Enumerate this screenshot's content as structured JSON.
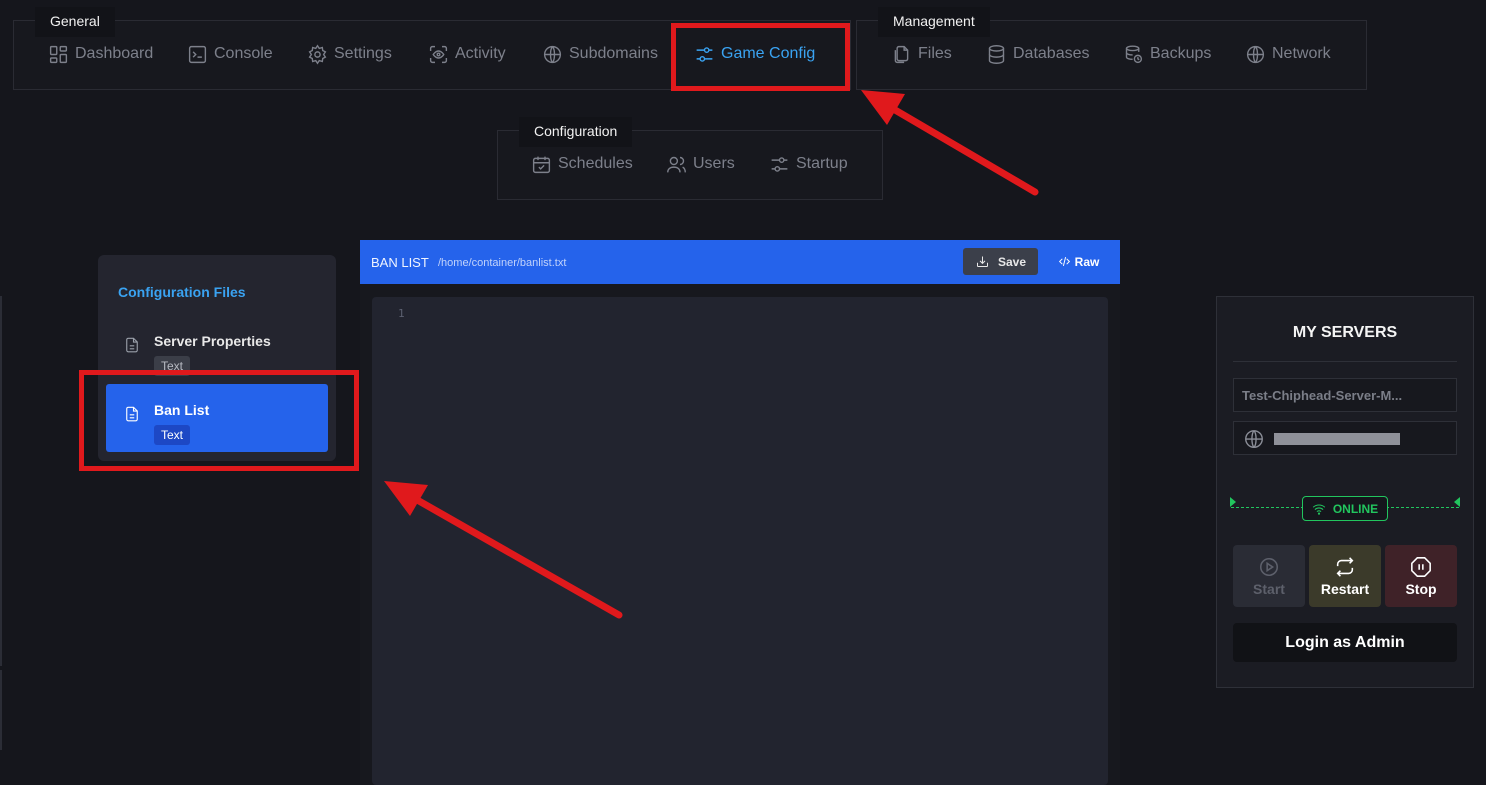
{
  "nav": {
    "general": {
      "label": "General",
      "items": [
        {
          "label": "Dashboard",
          "icon": "dashboard-icon"
        },
        {
          "label": "Console",
          "icon": "console-icon"
        },
        {
          "label": "Settings",
          "icon": "gear-icon"
        },
        {
          "label": "Activity",
          "icon": "activity-icon"
        },
        {
          "label": "Subdomains",
          "icon": "globe-icon"
        },
        {
          "label": "Game Config",
          "icon": "sliders-icon",
          "active": true
        }
      ]
    },
    "management": {
      "label": "Management",
      "items": [
        {
          "label": "Files",
          "icon": "files-icon"
        },
        {
          "label": "Databases",
          "icon": "database-icon"
        },
        {
          "label": "Backups",
          "icon": "backup-icon"
        },
        {
          "label": "Network",
          "icon": "globe-icon"
        }
      ]
    },
    "configuration": {
      "label": "Configuration",
      "items": [
        {
          "label": "Schedules",
          "icon": "calendar-icon"
        },
        {
          "label": "Users",
          "icon": "users-icon"
        },
        {
          "label": "Startup",
          "icon": "sliders-icon"
        }
      ]
    }
  },
  "config_files": {
    "title": "Configuration Files",
    "items": [
      {
        "name": "Server Properties",
        "tag": "Text",
        "selected": false
      },
      {
        "name": "Ban List",
        "tag": "Text",
        "selected": true
      }
    ]
  },
  "editor": {
    "file_name": "BAN LIST",
    "file_path": "/home/container/banlist.txt",
    "save_label": "Save",
    "raw_label": "Raw",
    "line_numbers": [
      "1"
    ]
  },
  "servers": {
    "title": "MY SERVERS",
    "server_name": "Test-Chiphead-Server-M...",
    "status": "ONLINE",
    "buttons": {
      "start": "Start",
      "restart": "Restart",
      "stop": "Stop"
    },
    "admin_label": "Login as Admin"
  },
  "colors": {
    "accent": "#2563eb",
    "active_nav": "#3aa3f2",
    "online": "#22c55e",
    "annotation": "#e0191c"
  }
}
